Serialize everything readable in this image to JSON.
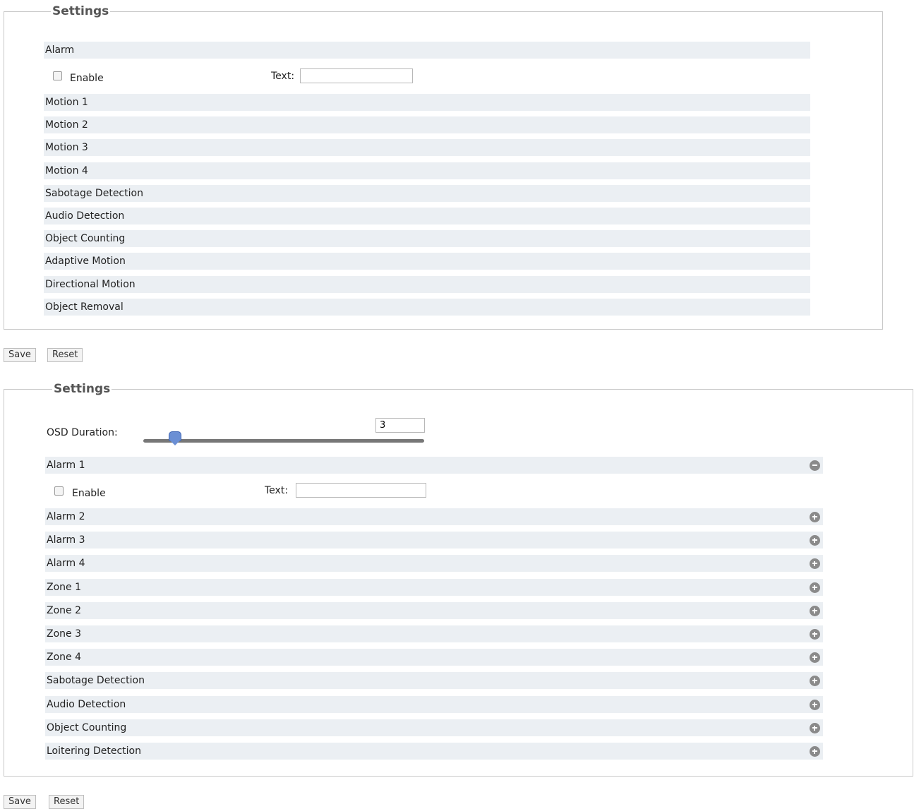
{
  "panel1": {
    "legend": "Settings",
    "header_label": "Alarm",
    "enable_label": "Enable",
    "text_label": "Text:",
    "text_value": "",
    "rows": [
      "Motion 1",
      "Motion 2",
      "Motion 3",
      "Motion 4",
      "Sabotage Detection",
      "Audio Detection",
      "Object Counting",
      "Adaptive Motion",
      "Directional Motion",
      "Object Removal"
    ]
  },
  "buttons1": {
    "save": "Save",
    "reset": "Reset"
  },
  "panel2": {
    "legend": "Settings",
    "osd_label": "OSD Duration:",
    "osd_value": "3",
    "header_label": "Alarm 1",
    "enable_label": "Enable",
    "text_label": "Text:",
    "text_value": "",
    "expand_icon": "minus-circle-icon",
    "row_icon": "plus-circle-icon",
    "rows": [
      "Alarm 2",
      "Alarm 3",
      "Alarm 4",
      "Zone 1",
      "Zone 2",
      "Zone 3",
      "Zone 4",
      "Sabotage Detection",
      "Audio Detection",
      "Object Counting",
      "Loitering Detection"
    ]
  },
  "buttons2": {
    "save": "Save",
    "reset": "Reset"
  }
}
